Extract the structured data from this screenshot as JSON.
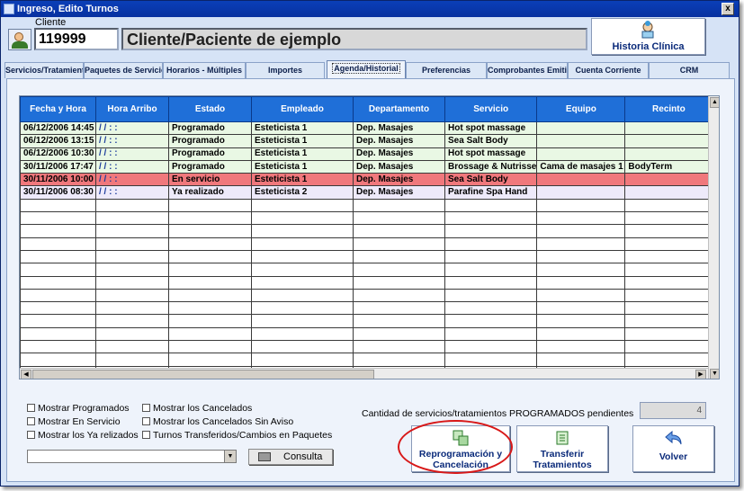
{
  "window": {
    "title": "Ingreso, Edito Turnos",
    "close": "x"
  },
  "cliente": {
    "label": "Cliente",
    "code": "119999",
    "name": "Cliente/Paciente de ejemplo"
  },
  "historia_button": "Historia Clínica",
  "tabs": [
    {
      "label": "Servicios/Tratamientos"
    },
    {
      "label": "Paquetes de Servicios"
    },
    {
      "label": "Horarios - Múltiples"
    },
    {
      "label": "Importes"
    },
    {
      "label": "Agenda/Historial",
      "active": true
    },
    {
      "label": "Preferencias"
    },
    {
      "label": "Comprobantes Emitidos"
    },
    {
      "label": "Cuenta Corriente"
    },
    {
      "label": "CRM"
    }
  ],
  "grid": {
    "columns": [
      "Fecha y Hora",
      "Hora Arribo",
      "Estado",
      "Empleado",
      "Departamento",
      "Servicio",
      "Equipo",
      "Recinto"
    ],
    "rows": [
      {
        "status": "programado",
        "cells": [
          "06/12/2006 14:45",
          "/ /      : :",
          "Programado",
          "Esteticista 1",
          "Dep. Masajes",
          "Hot spot massage",
          "",
          ""
        ]
      },
      {
        "status": "programado",
        "cells": [
          "06/12/2006 13:15",
          "/ /      : :",
          "Programado",
          "Esteticista 1",
          "Dep. Masajes",
          "Sea Salt Body",
          "",
          ""
        ]
      },
      {
        "status": "programado",
        "cells": [
          "06/12/2006 10:30",
          "/ /      : :",
          "Programado",
          "Esteticista 1",
          "Dep. Masajes",
          "Hot spot massage",
          "",
          ""
        ]
      },
      {
        "status": "programado",
        "cells": [
          "30/11/2006 17:47",
          "/ /      : :",
          "Programado",
          "Esteticista 1",
          "Dep. Masajes",
          "Brossage & Nutrisse",
          "Cama de masajes 1",
          "BodyTerm"
        ]
      },
      {
        "status": "enservicio",
        "cells": [
          "30/11/2006 10:00",
          "/ /      : :",
          "En servicio",
          "Esteticista 1",
          "Dep. Masajes",
          "Sea Salt Body",
          "",
          ""
        ]
      },
      {
        "status": "realizado",
        "cells": [
          "30/11/2006 08:30",
          "/ /      : :",
          "Ya realizado",
          "Esteticista 2",
          "Dep. Masajes",
          "Parafine Spa Hand",
          "",
          ""
        ]
      }
    ]
  },
  "checkboxes": {
    "programados": "Mostrar Programados",
    "en_servicio": "Mostrar En Servicio",
    "realizados": "Mostrar los Ya relizados",
    "cancelados": "Mostrar los Cancelados",
    "cancelados_sin_aviso": "Mostrar los Cancelados Sin Aviso",
    "transferidos": "Turnos Transferidos/Cambios en Paquetes"
  },
  "pendientes": {
    "label": "Cantidad de servicios/tratamientos PROGRAMADOS pendientes",
    "value": "4"
  },
  "consulta_button": "Consulta",
  "buttons": {
    "reprogramacion": [
      "Reprogramación y",
      "Cancelación"
    ],
    "transferir": [
      "Transferir",
      "Tratamientos"
    ],
    "volver": "Volver"
  },
  "colors": {
    "header": "#1f6fd8",
    "programado": "#e9f8e4",
    "en_servicio": "#f0787c",
    "realizado": "#eeeafa",
    "highlight": "#d81818"
  },
  "icons": [
    "client-icon",
    "doctor-icon",
    "printer-icon",
    "reschedule-icon",
    "transfer-icon",
    "back-arrow-icon",
    "close-icon"
  ]
}
